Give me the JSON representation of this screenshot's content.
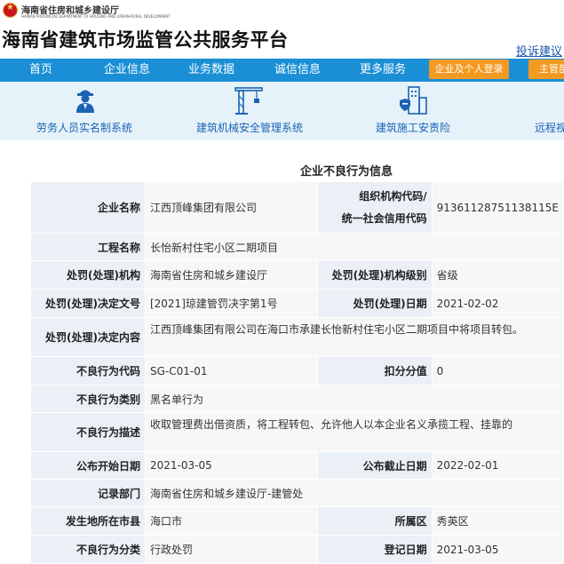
{
  "header": {
    "dept_name": "海南省住房和城乡建设厅",
    "dept_name_en": "HAINAN PROVINCIAL DEPARTMENT OF HOUSING AND URBAN-RURAL DEVELOPMENT",
    "site_title": "海南省建筑市场监管公共服务平台",
    "complaint_link": "投诉建议"
  },
  "nav": {
    "items": [
      "首页",
      "企业信息",
      "业务数据",
      "诚信信息",
      "更多服务"
    ],
    "login_button": "企业及个人登录",
    "competent_button": "主管部"
  },
  "services": [
    {
      "label": "劳务人员实名制系统",
      "icon": "worker-icon"
    },
    {
      "label": "建筑机械安全管理系统",
      "icon": "tower-crane-icon"
    },
    {
      "label": "建筑施工安责险",
      "icon": "insurance-building-icon"
    },
    {
      "label": "远程视",
      "icon": "remote-video-icon"
    }
  ],
  "record": {
    "title": "企业不良行为信息",
    "enterprise_name_label": "企业名称",
    "enterprise_name": "江西顶峰集团有限公司",
    "org_code_label_1": "组织机构代码/",
    "org_code_label_2": "统一社会信用代码",
    "org_code": "91361128751138115E",
    "project_label": "工程名称",
    "project": "长怡新村住宅小区二期项目",
    "authority_label": "处罚(处理)机构",
    "authority": "海南省住房和城乡建设厅",
    "authority_level_label": "处罚(处理)机构级别",
    "authority_level": "省级",
    "decision_no_label": "处罚(处理)决定文号",
    "decision_no": "[2021]琼建管罚决字第1号",
    "decision_date_label": "处罚(处理)日期",
    "decision_date": "2021-02-02",
    "decision_content_label": "处罚(处理)决定内容",
    "decision_content": "江西顶峰集团有限公司在海口市承建长怡新村住宅小区二期项目中将项目转包。",
    "behavior_code_label": "不良行为代码",
    "behavior_code": "SG-C01-01",
    "deduction_label": "扣分分值",
    "deduction": "0",
    "category_label": "不良行为类别",
    "category": "黑名单行为",
    "description_label": "不良行为描述",
    "description": "收取管理费出借资质，将工程转包、允许他人以本企业名义承揽工程、挂靠的",
    "publish_start_label": "公布开始日期",
    "publish_start": "2021-03-05",
    "publish_end_label": "公布截止日期",
    "publish_end": "2022-02-01",
    "record_dept_label": "记录部门",
    "record_dept": "海南省住房和城乡建设厅-建管处",
    "city_label": "发生地所在市县",
    "city": "海口市",
    "district_label": "所属区",
    "district": "秀英区",
    "classification_label": "不良行为分类",
    "classification": "行政处罚",
    "register_date_label": "登记日期",
    "register_date": "2021-03-05"
  },
  "colors": {
    "nav_bg": "#1a8fd6",
    "accent_button": "#f39a22",
    "service_band_bg": "#e6f2fa",
    "link": "#1a56a8",
    "label_cell_bg": "#eaf0f6",
    "value_cell_bg": "#f7f7f7"
  }
}
